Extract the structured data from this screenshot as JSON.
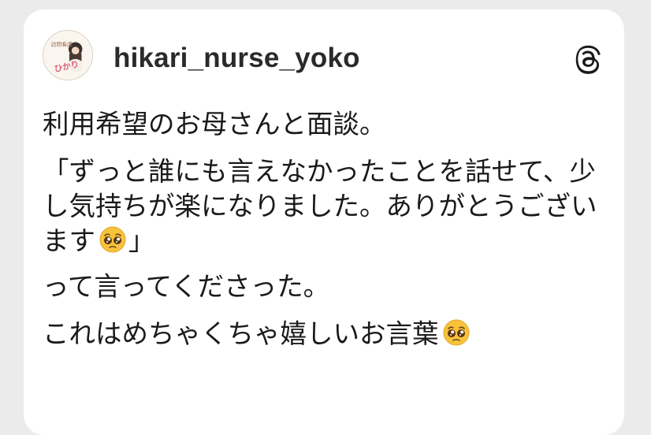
{
  "post": {
    "username": "hikari_nurse_yoko",
    "avatar_text": "ひかり",
    "avatar_subtext": "訪問看護",
    "paragraphs": [
      "利用希望のお母さんと面談。",
      "「ずっと誰にも言えなかったことを話せて、少し気持ちが楽になりました。ありがとうございます",
      "」",
      "って言ってくださった。",
      "これはめちゃくちゃ嬉しいお言葉"
    ],
    "emoji_name": "pleading-face-emoji"
  },
  "icons": {
    "platform": "threads-icon"
  },
  "colors": {
    "background": "#ebebeb",
    "card": "#ffffff",
    "text": "#1a1a1a",
    "username": "#2a2a2a",
    "emoji_face": "#f7c33b"
  }
}
